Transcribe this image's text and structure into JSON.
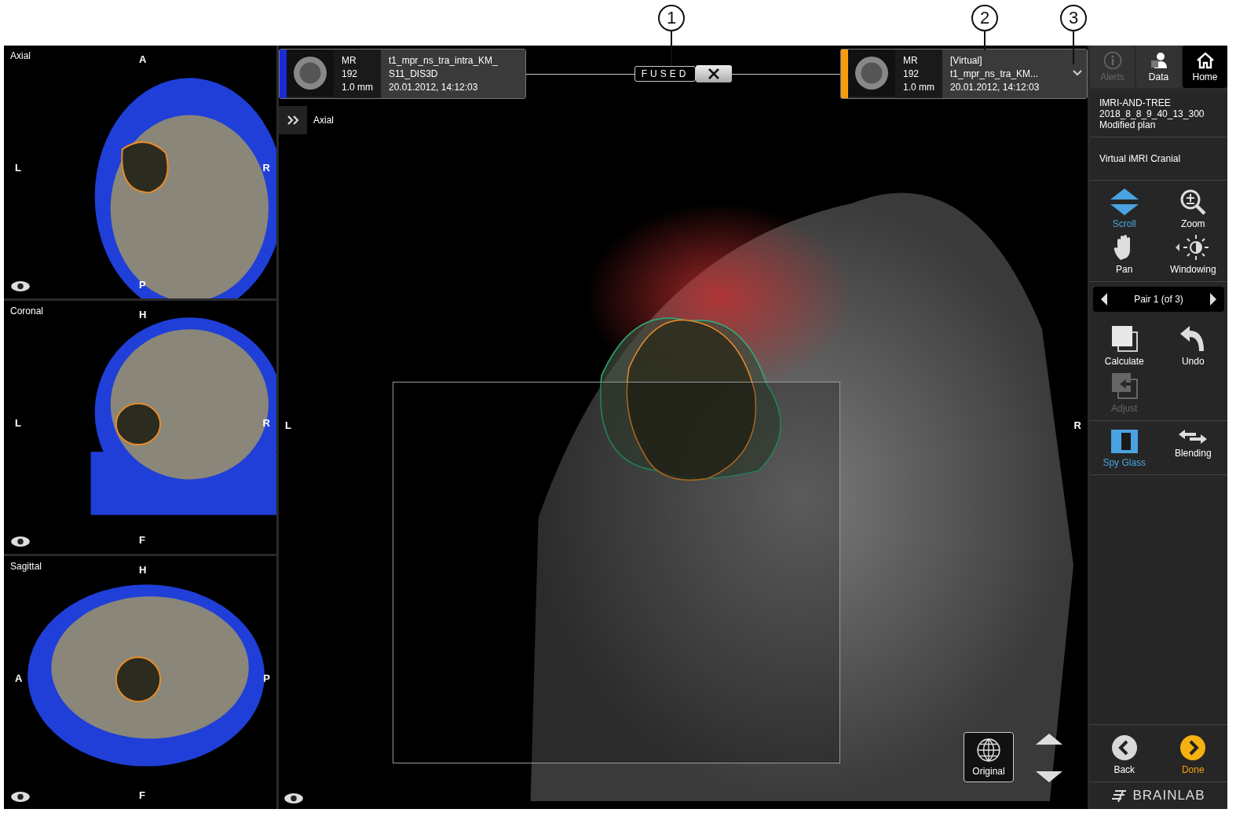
{
  "callouts": [
    {
      "number": "1"
    },
    {
      "number": "2"
    },
    {
      "number": "3"
    }
  ],
  "small_views": [
    {
      "title": "Axial",
      "top": "A",
      "left": "L",
      "right": "R",
      "bottom": "P",
      "kind": "axial"
    },
    {
      "title": "Coronal",
      "top": "H",
      "left": "L",
      "right": "R",
      "bottom": "F",
      "kind": "coronal"
    },
    {
      "title": "Sagittal",
      "top": "H",
      "left": "A",
      "right": "P",
      "bottom": "F",
      "kind": "sagittal"
    }
  ],
  "series": [
    {
      "modality": "MR",
      "slices": "192",
      "thickness": "1.0 mm",
      "lines": [
        "t1_mpr_ns_tra_intra_KM_",
        "S11_DIS3D"
      ],
      "date": "20.01.2012, 14:12:03",
      "color": "#1a2bd6",
      "menu": false
    },
    {
      "modality": "MR",
      "slices": "192",
      "thickness": "1.0 mm",
      "lines": [
        "[Virtual]",
        "t1_mpr_ns_tra_KM..."
      ],
      "date": "20.01.2012, 14:12:03",
      "color": "#f59b0c",
      "menu": true
    }
  ],
  "fused_label": "FUSED",
  "main_view": {
    "title": "Axial",
    "left": "L",
    "right": "R",
    "original_button": "Original"
  },
  "tabs": [
    {
      "label": "Alerts",
      "selected": false,
      "disabled": true
    },
    {
      "label": "Data",
      "selected": false,
      "disabled": false
    },
    {
      "label": "Home",
      "selected": true,
      "disabled": false
    }
  ],
  "plan": [
    "IMRI-AND-TREE",
    "2018_8_8_9_40_13_300",
    "Modified plan"
  ],
  "workflow": "Virtual iMRI Cranial",
  "tools": [
    {
      "label": "Scroll",
      "kind": "scroll",
      "active": true
    },
    {
      "label": "Zoom",
      "kind": "zoom",
      "active": false
    },
    {
      "label": "Pan",
      "kind": "pan",
      "active": false
    },
    {
      "label": "Windowing",
      "kind": "windowing",
      "active": false
    }
  ],
  "pair_selector": "Pair 1 (of 3)",
  "actions": [
    {
      "label": "Calculate",
      "kind": "calculate",
      "disabled": false
    },
    {
      "label": "Undo",
      "kind": "undo",
      "disabled": false
    },
    {
      "label": "Adjust",
      "kind": "adjust",
      "disabled": true
    }
  ],
  "view_modes": [
    {
      "label": "Spy Glass",
      "kind": "spyglass",
      "active": true
    },
    {
      "label": "Blending",
      "kind": "blending",
      "active": false
    }
  ],
  "back": "Back",
  "done": "Done",
  "brand": "BRAINLAB"
}
